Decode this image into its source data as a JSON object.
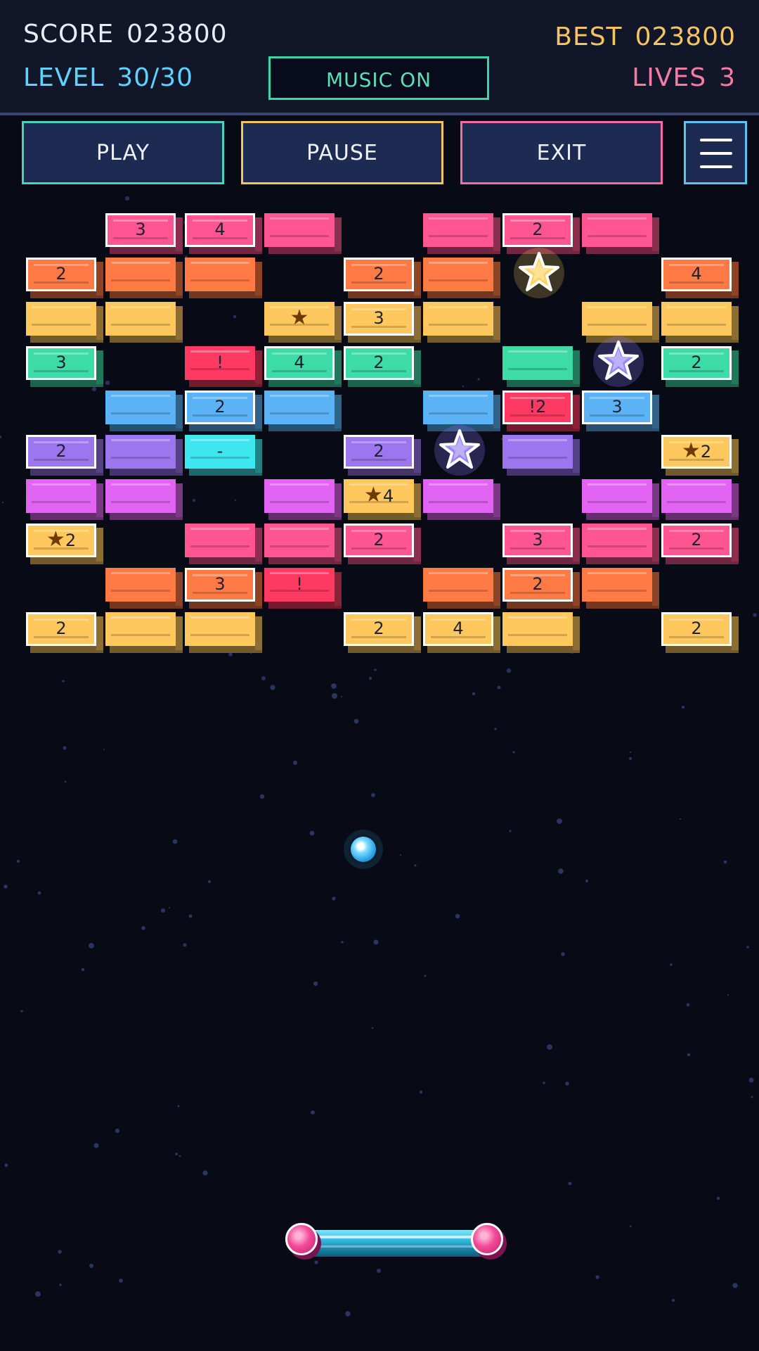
{
  "hud": {
    "score_label": "SCORE",
    "score_value": "023800",
    "best_label": "BEST",
    "best_value": "023800",
    "level_label": "LEVEL",
    "level_value": "30/30",
    "lives_label": "LIVES",
    "lives_value": "3",
    "music_label": "MUSIC  ON"
  },
  "buttons": {
    "play": "PLAY",
    "pause": "PAUSE",
    "exit": "EXIT",
    "menu_icon": "hamburger-menu-icon"
  },
  "colors": {
    "pink": "#ff5590",
    "orange": "#ff7a45",
    "yellow": "#ffc85e",
    "green": "#3ddba5",
    "blue": "#5bb3f5",
    "red": "#ff3a62",
    "cyan": "#3ee6ef",
    "violet": "#9b76ef",
    "magenta": "#e264f2"
  },
  "bricks": [
    {
      "row": 0,
      "col": 1,
      "color": "pink",
      "label": "3",
      "hit": true
    },
    {
      "row": 0,
      "col": 2,
      "color": "pink",
      "label": "4",
      "hit": true
    },
    {
      "row": 0,
      "col": 3,
      "color": "pink",
      "label": ""
    },
    {
      "row": 0,
      "col": 5,
      "color": "pink",
      "label": ""
    },
    {
      "row": 0,
      "col": 6,
      "color": "pink",
      "label": "2",
      "hit": true
    },
    {
      "row": 0,
      "col": 7,
      "color": "pink",
      "label": ""
    },
    {
      "row": 1,
      "col": 0,
      "color": "orange",
      "label": "2",
      "hit": true
    },
    {
      "row": 1,
      "col": 1,
      "color": "orange",
      "label": ""
    },
    {
      "row": 1,
      "col": 2,
      "color": "orange",
      "label": ""
    },
    {
      "row": 1,
      "col": 4,
      "color": "orange",
      "label": "2",
      "hit": true
    },
    {
      "row": 1,
      "col": 5,
      "color": "orange",
      "label": ""
    },
    {
      "row": 1,
      "col": 8,
      "color": "orange",
      "label": "4",
      "hit": true
    },
    {
      "row": 2,
      "col": 0,
      "color": "yellow",
      "label": ""
    },
    {
      "row": 2,
      "col": 1,
      "color": "yellow",
      "label": ""
    },
    {
      "row": 2,
      "col": 3,
      "color": "yellow",
      "label": "",
      "star": true
    },
    {
      "row": 2,
      "col": 4,
      "color": "yellow",
      "label": "3",
      "hit": true
    },
    {
      "row": 2,
      "col": 5,
      "color": "yellow",
      "label": ""
    },
    {
      "row": 2,
      "col": 7,
      "color": "yellow",
      "label": ""
    },
    {
      "row": 2,
      "col": 8,
      "color": "yellow",
      "label": ""
    },
    {
      "row": 3,
      "col": 0,
      "color": "green",
      "label": "3",
      "hit": true
    },
    {
      "row": 3,
      "col": 2,
      "color": "red",
      "label": "!"
    },
    {
      "row": 3,
      "col": 3,
      "color": "green",
      "label": "4",
      "hit": true
    },
    {
      "row": 3,
      "col": 4,
      "color": "green",
      "label": "2",
      "hit": true
    },
    {
      "row": 3,
      "col": 6,
      "color": "green",
      "label": ""
    },
    {
      "row": 3,
      "col": 8,
      "color": "green",
      "label": "2",
      "hit": true
    },
    {
      "row": 4,
      "col": 1,
      "color": "blue",
      "label": ""
    },
    {
      "row": 4,
      "col": 2,
      "color": "blue",
      "label": "2",
      "hit": true
    },
    {
      "row": 4,
      "col": 3,
      "color": "blue",
      "label": ""
    },
    {
      "row": 4,
      "col": 5,
      "color": "blue",
      "label": ""
    },
    {
      "row": 4,
      "col": 6,
      "color": "red",
      "label": "!2",
      "hit": true
    },
    {
      "row": 4,
      "col": 7,
      "color": "blue",
      "label": "3",
      "hit": true
    },
    {
      "row": 5,
      "col": 0,
      "color": "violet",
      "label": "2",
      "hit": true
    },
    {
      "row": 5,
      "col": 1,
      "color": "violet",
      "label": ""
    },
    {
      "row": 5,
      "col": 2,
      "color": "cyan",
      "label": "-"
    },
    {
      "row": 5,
      "col": 4,
      "color": "violet",
      "label": "2",
      "hit": true
    },
    {
      "row": 5,
      "col": 6,
      "color": "violet",
      "label": ""
    },
    {
      "row": 5,
      "col": 8,
      "color": "yellow",
      "label": "2",
      "star": true,
      "hit": true
    },
    {
      "row": 6,
      "col": 0,
      "color": "magenta",
      "label": ""
    },
    {
      "row": 6,
      "col": 1,
      "color": "magenta",
      "label": ""
    },
    {
      "row": 6,
      "col": 3,
      "color": "magenta",
      "label": ""
    },
    {
      "row": 6,
      "col": 4,
      "color": "yellow",
      "label": "4",
      "star": true
    },
    {
      "row": 6,
      "col": 5,
      "color": "magenta",
      "label": ""
    },
    {
      "row": 6,
      "col": 7,
      "color": "magenta",
      "label": ""
    },
    {
      "row": 6,
      "col": 8,
      "color": "magenta",
      "label": ""
    },
    {
      "row": 7,
      "col": 0,
      "color": "yellow",
      "label": "2",
      "star": true,
      "hit": true
    },
    {
      "row": 7,
      "col": 2,
      "color": "pink",
      "label": ""
    },
    {
      "row": 7,
      "col": 3,
      "color": "pink",
      "label": ""
    },
    {
      "row": 7,
      "col": 4,
      "color": "pink",
      "label": "2",
      "hit": true
    },
    {
      "row": 7,
      "col": 6,
      "color": "pink",
      "label": "3",
      "hit": true
    },
    {
      "row": 7,
      "col": 7,
      "color": "pink",
      "label": ""
    },
    {
      "row": 7,
      "col": 8,
      "color": "pink",
      "label": "2",
      "hit": true
    },
    {
      "row": 8,
      "col": 1,
      "color": "orange",
      "label": ""
    },
    {
      "row": 8,
      "col": 2,
      "color": "orange",
      "label": "3",
      "hit": true
    },
    {
      "row": 8,
      "col": 3,
      "color": "red",
      "label": "!"
    },
    {
      "row": 8,
      "col": 5,
      "color": "orange",
      "label": ""
    },
    {
      "row": 8,
      "col": 6,
      "color": "orange",
      "label": "2",
      "hit": true
    },
    {
      "row": 8,
      "col": 7,
      "color": "orange",
      "label": ""
    },
    {
      "row": 9,
      "col": 0,
      "color": "yellow",
      "label": "2",
      "hit": true
    },
    {
      "row": 9,
      "col": 1,
      "color": "yellow",
      "label": ""
    },
    {
      "row": 9,
      "col": 2,
      "color": "yellow",
      "label": ""
    },
    {
      "row": 9,
      "col": 4,
      "color": "yellow",
      "label": "2",
      "hit": true
    },
    {
      "row": 9,
      "col": 5,
      "color": "yellow",
      "label": "4",
      "hit": true
    },
    {
      "row": 9,
      "col": 6,
      "color": "yellow",
      "label": ""
    },
    {
      "row": 9,
      "col": 8,
      "color": "yellow",
      "label": "2",
      "hit": true
    }
  ],
  "powerups": [
    {
      "row": 1,
      "col": 6,
      "type": "gold-star-powerup",
      "color": "#ffd35e"
    },
    {
      "row": 3,
      "col": 7,
      "type": "purple-star-powerup",
      "color": "#9b86f5"
    },
    {
      "row": 5,
      "col": 5,
      "type": "purple-star-powerup",
      "color": "#9b86f5"
    }
  ]
}
